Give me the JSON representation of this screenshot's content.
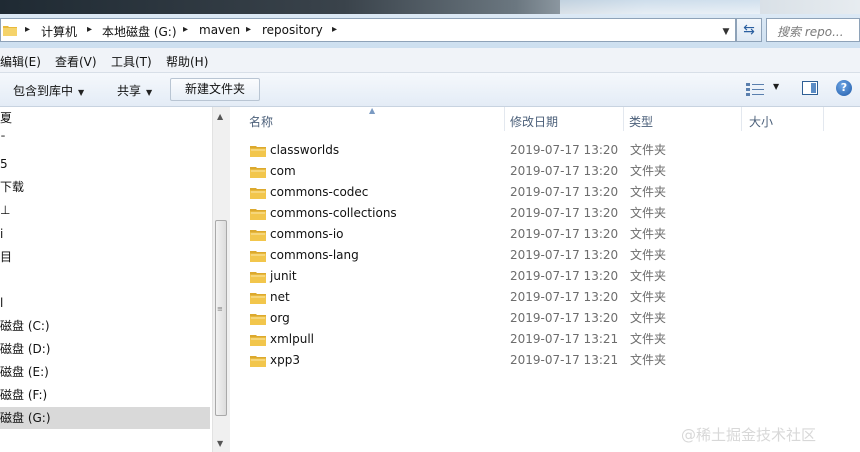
{
  "address_bar": {
    "breadcrumbs": [
      "计算机",
      "本地磁盘 (G:)",
      "maven",
      "repository"
    ],
    "search_placeholder": "搜索 repo..."
  },
  "menu": [
    "编辑(E)",
    "查看(V)",
    "工具(T)",
    "帮助(H)"
  ],
  "commands": {
    "include_in_library": "包含到库中",
    "share": "共享",
    "new_folder": "新建文件夹"
  },
  "nav_pane": {
    "items": [
      "夏",
      "ˉ",
      "5",
      "下载",
      "⊥",
      "i",
      "目",
      "",
      "l",
      "磁盘 (C:)",
      "磁盘 (D:)",
      "磁盘 (E:)",
      "磁盘 (F:)",
      "磁盘 (G:)"
    ],
    "selected_index": 13
  },
  "file_list": {
    "columns": [
      "名称",
      "修改日期",
      "类型",
      "大小"
    ],
    "rows": [
      {
        "name": "classworlds",
        "date": "2019-07-17 13:20",
        "type": "文件夹"
      },
      {
        "name": "com",
        "date": "2019-07-17 13:20",
        "type": "文件夹"
      },
      {
        "name": "commons-codec",
        "date": "2019-07-17 13:20",
        "type": "文件夹"
      },
      {
        "name": "commons-collections",
        "date": "2019-07-17 13:20",
        "type": "文件夹"
      },
      {
        "name": "commons-io",
        "date": "2019-07-17 13:20",
        "type": "文件夹"
      },
      {
        "name": "commons-lang",
        "date": "2019-07-17 13:20",
        "type": "文件夹"
      },
      {
        "name": "junit",
        "date": "2019-07-17 13:20",
        "type": "文件夹"
      },
      {
        "name": "net",
        "date": "2019-07-17 13:20",
        "type": "文件夹"
      },
      {
        "name": "org",
        "date": "2019-07-17 13:20",
        "type": "文件夹"
      },
      {
        "name": "xmlpull",
        "date": "2019-07-17 13:21",
        "type": "文件夹"
      },
      {
        "name": "xpp3",
        "date": "2019-07-17 13:21",
        "type": "文件夹"
      }
    ]
  },
  "watermark": "@稀土掘金技术社区",
  "colors": {
    "folder": "#f2c64c",
    "header_text": "#4c607a",
    "selection": "#d9d9d9"
  }
}
